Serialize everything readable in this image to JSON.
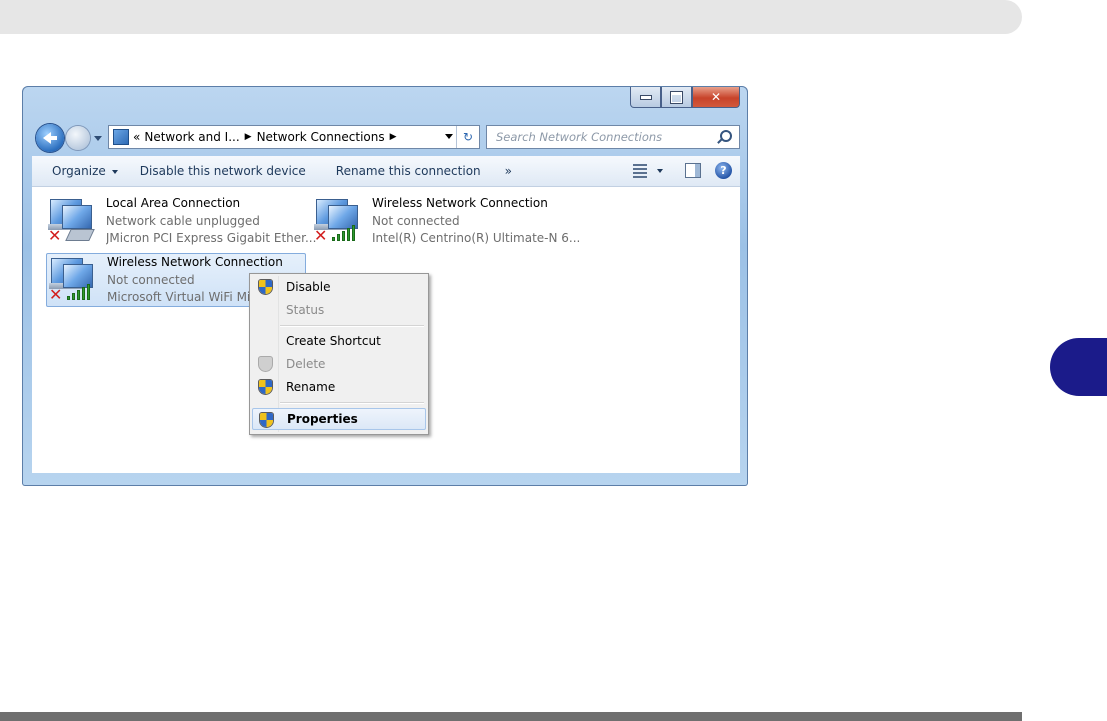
{
  "window": {
    "address": {
      "crumb_prefix": "«",
      "crumb1": "Network and I...",
      "crumb2": "Network Connections"
    },
    "search": {
      "placeholder": "Search Network Connections"
    },
    "toolbar": {
      "organize": "Organize",
      "disable": "Disable this network device",
      "rename": "Rename this connection",
      "more": "»",
      "help": "?"
    },
    "connections": [
      {
        "name": "Local Area Connection",
        "status": "Network cable unplugged",
        "device": "JMicron PCI Express Gigabit Ether..."
      },
      {
        "name": "Wireless Network Connection",
        "status": "Not connected",
        "device": "Intel(R) Centrino(R) Ultimate-N 6..."
      },
      {
        "name": "Wireless Network Connection",
        "status": "Not connected",
        "device": "Microsoft Virtual WiFi Min"
      }
    ],
    "context_menu": {
      "disable": "Disable",
      "status": "Status",
      "create_shortcut": "Create Shortcut",
      "delete": "Delete",
      "rename": "Rename",
      "properties": "Properties"
    }
  }
}
